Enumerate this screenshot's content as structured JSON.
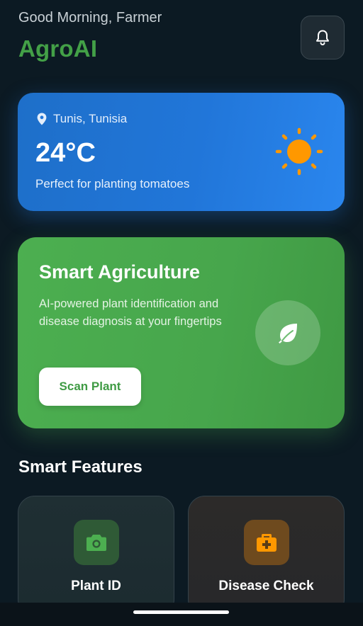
{
  "header": {
    "greeting": "Good Morning, Farmer",
    "brand": "AgroAI",
    "notification_icon": "bell-icon"
  },
  "weather": {
    "location": "Tunis, Tunisia",
    "location_icon": "location-pin-icon",
    "temperature": "24°C",
    "description": "Perfect for planting tomatoes",
    "condition_icon": "sun-icon"
  },
  "hero": {
    "title": "Smart Agriculture",
    "description": "AI-powered plant identification and disease diagnosis at your fingertips",
    "button_label": "Scan Plant",
    "icon": "leaf-icon"
  },
  "features": {
    "section_title": "Smart Features",
    "items": [
      {
        "label": "Plant ID",
        "icon": "camera-icon",
        "accent": "#4caf50"
      },
      {
        "label": "Disease Check",
        "icon": "medical-kit-icon",
        "accent": "#ff9800"
      }
    ]
  },
  "colors": {
    "background": "#0c1a23",
    "brand": "#43a047",
    "weather_card": "#2176d9",
    "hero_card": "#4caf50",
    "sun": "#ff9800"
  }
}
